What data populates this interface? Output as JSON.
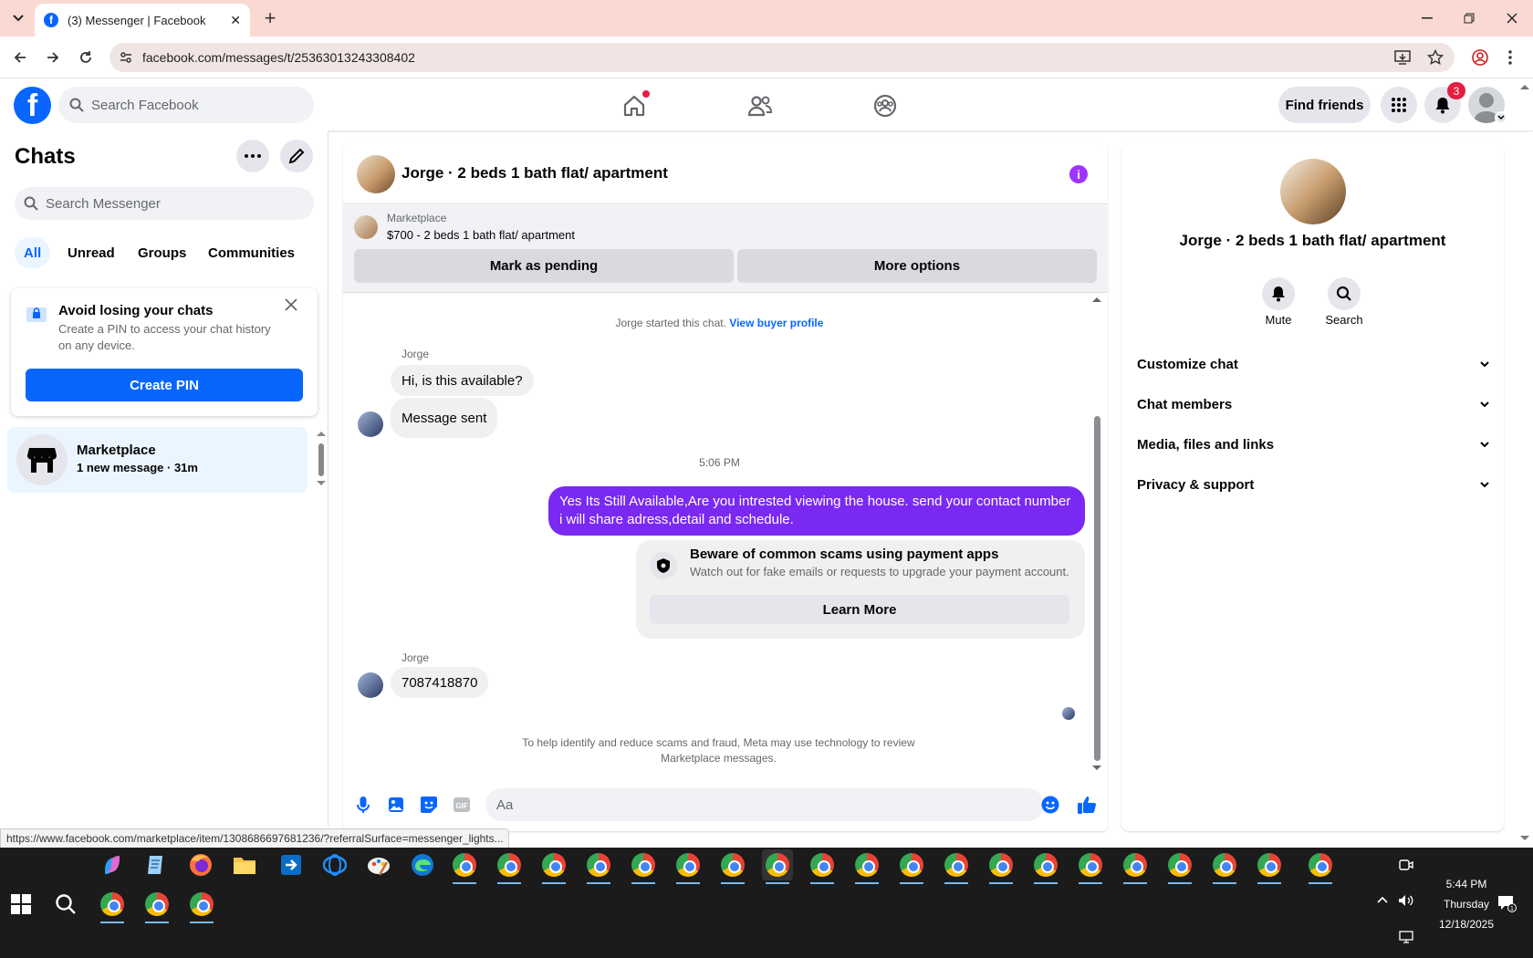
{
  "browser": {
    "tab_title": "(3) Messenger | Facebook",
    "tab_favicon": "facebook-favicon",
    "url": "facebook.com/messages/t/25363013243308402",
    "status_url": "https://www.facebook.com/marketplace/item/1308686697681236/?referralSurface=messenger_lights..."
  },
  "fb_header": {
    "search_placeholder": "Search Facebook",
    "find_friends": "Find friends",
    "notification_count": "3"
  },
  "left": {
    "title": "Chats",
    "search_placeholder": "Search Messenger",
    "filters": [
      "All",
      "Unread",
      "Groups",
      "Communities"
    ],
    "pin_card": {
      "title": "Avoid losing your chats",
      "body": "Create a PIN to access your chat history on any device.",
      "button": "Create PIN"
    },
    "chat_item": {
      "name": "Marketplace",
      "subtitle": "1 new message · 31m"
    }
  },
  "conversation": {
    "title": "Jorge · 2 beds 1 bath flat/ apartment",
    "marketplace_label": "Marketplace",
    "listing": "$700 - 2 beds 1 bath flat/ apartment",
    "mark_pending": "Mark as pending",
    "more_options": "More options",
    "started_text": "Jorge started this chat.",
    "buyer_profile_link": "View buyer profile",
    "sender1": "Jorge",
    "msg1": "Hi, is this available?",
    "msg2": "Message sent",
    "timestamp": "5:06 PM",
    "outgoing": "Yes Its Still Available,Are you intrested viewing the house. send your contact number i will share adress,detail and schedule.",
    "scam_title": "Beware of common scams using payment apps",
    "scam_body": "Watch out for fake emails or requests to upgrade your payment account.",
    "learn_more": "Learn More",
    "sender2": "Jorge",
    "msg3": "7087418870",
    "disclaimer": "To help identify and reduce scams and fraud, Meta may use technology to review Marketplace messages.",
    "input_placeholder": "Aa"
  },
  "right": {
    "name": "Jorge · 2 beds 1 bath flat/ apartment",
    "mute": "Mute",
    "search": "Search",
    "sections": [
      "Customize chat",
      "Chat members",
      "Media, files and links",
      "Privacy & support"
    ]
  },
  "taskbar": {
    "time": "5:44 PM",
    "day": "Thursday",
    "date": "12/18/2025"
  },
  "colors": {
    "fb_blue": "#0866ff",
    "outgoing_purple": "#7a29f2",
    "badge_red": "#e41e3f"
  }
}
